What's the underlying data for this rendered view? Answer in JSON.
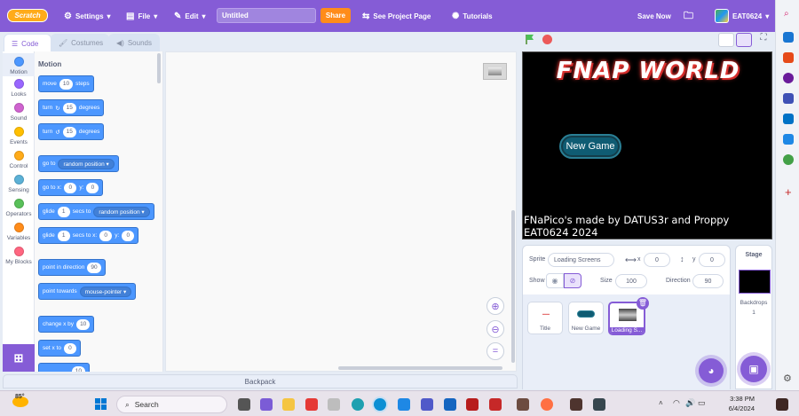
{
  "menubar": {
    "logo": "Scratch",
    "settings": "Settings",
    "file": "File",
    "edit": "Edit",
    "project_title": "Untitled",
    "share": "Share",
    "see_project_page": "See Project Page",
    "tutorials": "Tutorials",
    "save_now": "Save Now",
    "username": "EAT0624"
  },
  "tabs": {
    "code": "Code",
    "costumes": "Costumes",
    "sounds": "Sounds"
  },
  "categories": [
    {
      "label": "Motion",
      "color": "#4c97ff"
    },
    {
      "label": "Looks",
      "color": "#9966ff"
    },
    {
      "label": "Sound",
      "color": "#cf63cf"
    },
    {
      "label": "Events",
      "color": "#ffbf00"
    },
    {
      "label": "Control",
      "color": "#ffab19"
    },
    {
      "label": "Sensing",
      "color": "#5cb1d6"
    },
    {
      "label": "Operators",
      "color": "#59c059"
    },
    {
      "label": "Variables",
      "color": "#ff8c1a"
    },
    {
      "label": "My Blocks",
      "color": "#ff6680"
    }
  ],
  "palette": {
    "heading": "Motion",
    "move": {
      "a": "move",
      "v": "10",
      "b": "steps"
    },
    "turn_right": {
      "a": "turn",
      "v": "15",
      "b": "degrees"
    },
    "turn_left": {
      "a": "turn",
      "v": "15",
      "b": "degrees"
    },
    "goto": {
      "a": "go to",
      "d": "random position"
    },
    "gotoxy": {
      "a": "go to x:",
      "x": "0",
      "b": "y:",
      "y": "0"
    },
    "glide_to": {
      "a": "glide",
      "v": "1",
      "b": "secs to",
      "d": "random position"
    },
    "glide_xy": {
      "a": "glide",
      "v": "1",
      "b": "secs to x:",
      "x": "0",
      "c": "y:",
      "y": "0"
    },
    "point_dir": {
      "a": "point in direction",
      "v": "90"
    },
    "point_towards": {
      "a": "point towards",
      "d": "mouse-pointer"
    },
    "change_x": {
      "a": "change x by",
      "v": "10"
    },
    "set_x": {
      "a": "set x to",
      "v": "0"
    },
    "partial": {
      "v": "10"
    }
  },
  "backpack": "Backpack",
  "stage": {
    "title": "FNAP WORLD",
    "button": "New Game",
    "credit1": "FNaPico's made by DATUS3r and Proppy",
    "credit2": "EAT0624 2024"
  },
  "sprite_info": {
    "sprite_label": "Sprite",
    "sprite_name": "Loading Screens",
    "x_label": "x",
    "x_value": "0",
    "y_label": "y",
    "y_value": "0",
    "show_label": "Show",
    "size_label": "Size",
    "size_value": "100",
    "direction_label": "Direction",
    "direction_value": "90"
  },
  "sprites": [
    {
      "name": "Title",
      "thumb": "title"
    },
    {
      "name": "New Game",
      "thumb": "button"
    },
    {
      "name": "Loading S...",
      "thumb": "loading"
    }
  ],
  "stage_pane": {
    "label": "Stage",
    "backdrops_label": "Backdrops",
    "backdrops_count": "1"
  },
  "taskbar": {
    "weather": "85°",
    "search": "Search",
    "time": "3:38 PM",
    "date": "6/4/2024"
  }
}
